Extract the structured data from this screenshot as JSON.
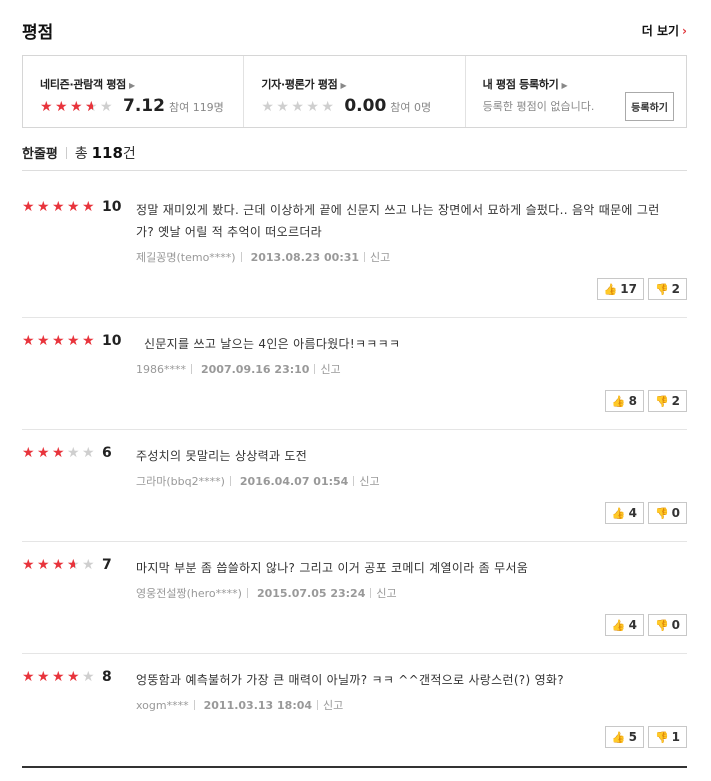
{
  "header": {
    "title": "평점",
    "more_label": "더 보기",
    "more_arrow": "›"
  },
  "summary": {
    "netizen": {
      "label": "네티즌·관람객 평점",
      "score": "7.12",
      "participants": "참여 119명",
      "star_level": 3.5
    },
    "critic": {
      "label": "기자·평론가 평점",
      "score": "0.00",
      "participants": "참여 0명",
      "star_level": 0
    },
    "mine": {
      "label": "내 평점 등록하기",
      "note": "등록한 평점이 없습니다.",
      "button": "등록하기"
    }
  },
  "count": {
    "label": "한줄평",
    "total_prefix": "총",
    "total_num": "118",
    "total_suffix": "건"
  },
  "reviews": [
    {
      "stars": 5,
      "score": "10",
      "text": "정말 재미있게 봤다. 근데 이상하게 끝에 신문지 쓰고 나는 장면에서 묘하게 슬펐다.. 음악 때문에 그런가? 옛날 어릴 적 추억이 떠오르더라",
      "author": "제길꽁명(temo****)",
      "date": "2013.08.23 00:31",
      "report": "신고",
      "up": "17",
      "down": "2"
    },
    {
      "stars": 5,
      "score": "10",
      "text": "신문지를 쓰고 날으는 4인은 아름다웠다!ㅋㅋㅋㅋ",
      "author": "1986****",
      "date": "2007.09.16 23:10",
      "report": "신고",
      "up": "8",
      "down": "2"
    },
    {
      "stars": 3,
      "score": "6",
      "text": "주성치의 못말리는 상상력과 도전",
      "author": "그라마(bbq2****)",
      "date": "2016.04.07 01:54",
      "report": "신고",
      "up": "4",
      "down": "0"
    },
    {
      "stars": 3.5,
      "score": "7",
      "text": "마지막 부분 좀 씁쓸하지 않나? 그리고 이거 공포 코메디 계열이라 좀 무서움",
      "author": "영웅전설짱(hero****)",
      "date": "2015.07.05 23:24",
      "report": "신고",
      "up": "4",
      "down": "0"
    },
    {
      "stars": 4,
      "score": "8",
      "text": "엉뚱함과 예측불허가 가장 큰 매력이 아닐까? ㅋㅋ ^^갠적으로 사랑스런(?) 영화?",
      "author": "xogm****",
      "date": "2011.03.13 18:04",
      "report": "신고",
      "up": "5",
      "down": "1"
    }
  ],
  "icons": {
    "thumb_up": "thumbs-up-icon",
    "thumb_down": "thumbs-down-icon",
    "star": "star-icon"
  },
  "colors": {
    "star_on": "#e8343c",
    "star_off": "#cfcfcf",
    "accent": "#e0393e"
  }
}
